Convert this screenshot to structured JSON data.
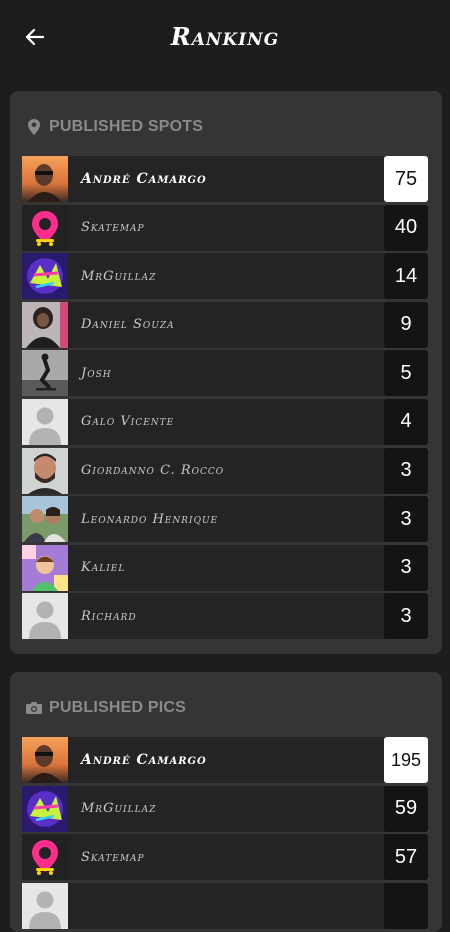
{
  "header": {
    "title": "Ranking"
  },
  "spots": {
    "title": "PUBLISHED SPOTS",
    "rows": [
      {
        "name": "André Camargo",
        "score": "75",
        "avatar": "photo-sunset"
      },
      {
        "name": "Skatemap",
        "score": "40",
        "avatar": "logo-pin"
      },
      {
        "name": "MrGuillaz",
        "score": "14",
        "avatar": "logo-graffiti"
      },
      {
        "name": "Daniel Souza",
        "score": "9",
        "avatar": "photo-woman"
      },
      {
        "name": "Josh",
        "score": "5",
        "avatar": "photo-skate"
      },
      {
        "name": "Galo Vicente",
        "score": "4",
        "avatar": "default"
      },
      {
        "name": "Giordanno C. Rocco",
        "score": "3",
        "avatar": "photo-man"
      },
      {
        "name": "Leonardo Henrique",
        "score": "3",
        "avatar": "photo-couple"
      },
      {
        "name": "Kaliel",
        "score": "3",
        "avatar": "photo-cartoon"
      },
      {
        "name": "Richard",
        "score": "3",
        "avatar": "default"
      }
    ]
  },
  "pics": {
    "title": "PUBLISHED PICS",
    "rows": [
      {
        "name": "André Camargo",
        "score": "195",
        "avatar": "photo-sunset"
      },
      {
        "name": "MrGuillaz",
        "score": "59",
        "avatar": "logo-graffiti"
      },
      {
        "name": "Skatemap",
        "score": "57",
        "avatar": "logo-pin"
      },
      {
        "name": "",
        "score": "",
        "avatar": "default"
      }
    ]
  },
  "colors": {
    "background": "#1d1d1d",
    "card": "#353535",
    "row": "#242424",
    "score_box": "#141414",
    "accent_pink": "#ff2d8b"
  }
}
